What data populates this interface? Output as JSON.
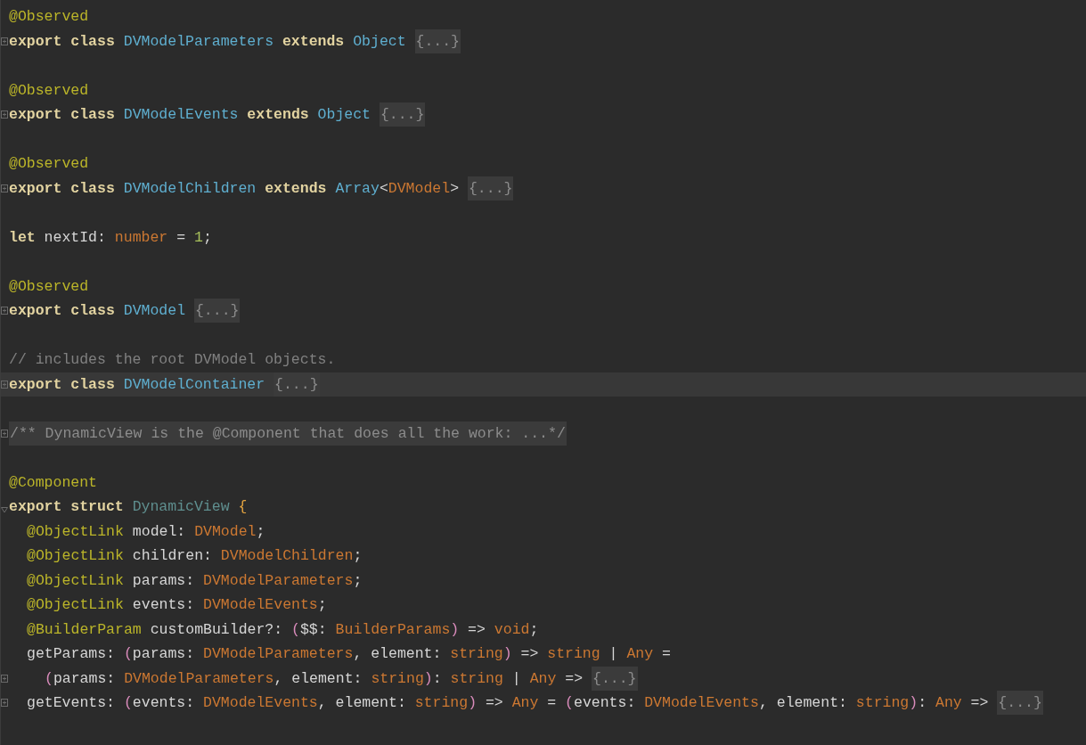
{
  "editor": {
    "lines": [
      {
        "kind": "code",
        "current": false,
        "tokens": [
          {
            "kind": "annotation",
            "text": "@Observed"
          }
        ]
      },
      {
        "kind": "code",
        "current": false,
        "collapsed": true,
        "tokens": [
          {
            "kind": "keyword",
            "text": "export class "
          },
          {
            "kind": "class",
            "text": "DVModelParameters"
          },
          {
            "kind": "keyword",
            "text": " extends "
          },
          {
            "kind": "class",
            "text": "Object "
          },
          {
            "kind": "folded",
            "text": "{...}"
          }
        ]
      },
      {
        "kind": "blank",
        "current": false
      },
      {
        "kind": "code",
        "current": false,
        "tokens": [
          {
            "kind": "annotation",
            "text": "@Observed"
          }
        ]
      },
      {
        "kind": "code",
        "current": false,
        "collapsed": true,
        "tokens": [
          {
            "kind": "keyword",
            "text": "export class "
          },
          {
            "kind": "class",
            "text": "DVModelEvents"
          },
          {
            "kind": "keyword",
            "text": " extends "
          },
          {
            "kind": "class",
            "text": "Object "
          },
          {
            "kind": "folded",
            "text": "{...}"
          }
        ]
      },
      {
        "kind": "blank",
        "current": false
      },
      {
        "kind": "code",
        "current": false,
        "tokens": [
          {
            "kind": "annotation",
            "text": "@Observed"
          }
        ]
      },
      {
        "kind": "code",
        "current": false,
        "collapsed": true,
        "tokens": [
          {
            "kind": "keyword",
            "text": "export class "
          },
          {
            "kind": "class",
            "text": "DVModelChildren"
          },
          {
            "kind": "keyword",
            "text": " extends "
          },
          {
            "kind": "class",
            "text": "Array"
          },
          {
            "kind": "plain",
            "text": "<"
          },
          {
            "kind": "type",
            "text": "DVModel"
          },
          {
            "kind": "plain",
            "text": "> "
          },
          {
            "kind": "folded",
            "text": "{...}"
          }
        ]
      },
      {
        "kind": "blank",
        "current": false
      },
      {
        "kind": "code",
        "current": false,
        "tokens": [
          {
            "kind": "keyword",
            "text": "let "
          },
          {
            "kind": "plain",
            "text": "nextId: "
          },
          {
            "kind": "type",
            "text": "number"
          },
          {
            "kind": "plain",
            "text": " = "
          },
          {
            "kind": "number",
            "text": "1"
          },
          {
            "kind": "plain",
            "text": ";"
          }
        ]
      },
      {
        "kind": "blank",
        "current": false
      },
      {
        "kind": "code",
        "current": false,
        "tokens": [
          {
            "kind": "annotation",
            "text": "@Observed"
          }
        ]
      },
      {
        "kind": "code",
        "current": false,
        "collapsed": true,
        "tokens": [
          {
            "kind": "keyword",
            "text": "export class "
          },
          {
            "kind": "class",
            "text": "DVModel "
          },
          {
            "kind": "folded",
            "text": "{...}"
          }
        ]
      },
      {
        "kind": "blank",
        "current": false
      },
      {
        "kind": "code",
        "current": false,
        "tokens": [
          {
            "kind": "comment",
            "text": "// includes the root DVModel objects."
          }
        ]
      },
      {
        "kind": "code",
        "current": true,
        "collapsed": true,
        "tokens": [
          {
            "kind": "keyword",
            "text": "export class "
          },
          {
            "kind": "class",
            "text": "DVModelContainer "
          },
          {
            "kind": "folded",
            "text": "{...}"
          }
        ]
      },
      {
        "kind": "blank",
        "current": false
      },
      {
        "kind": "code",
        "current": false,
        "collapsed": true,
        "tokens": [
          {
            "kind": "folded_comment",
            "text": "/** DynamicView is the @Component that does all the work: ...*/"
          }
        ]
      },
      {
        "kind": "blank",
        "current": false
      },
      {
        "kind": "code",
        "current": false,
        "tokens": [
          {
            "kind": "annotation",
            "text": "@Component"
          }
        ]
      },
      {
        "kind": "code",
        "current": false,
        "collapsed": false,
        "tokens": [
          {
            "kind": "keyword",
            "text": "export struct "
          },
          {
            "kind": "struct_name",
            "text": "DynamicView "
          },
          {
            "kind": "brace",
            "text": "{"
          }
        ],
        "children": [
          {
            "kind": "code",
            "current": false,
            "tokens": [
              {
                "kind": "annotation",
                "text": "@ObjectLink"
              },
              {
                "kind": "plain",
                "text": " model: "
              },
              {
                "kind": "type",
                "text": "DVModel"
              },
              {
                "kind": "plain",
                "text": ";"
              }
            ]
          },
          {
            "kind": "code",
            "current": false,
            "tokens": [
              {
                "kind": "annotation",
                "text": "@ObjectLink"
              },
              {
                "kind": "plain",
                "text": " children: "
              },
              {
                "kind": "type",
                "text": "DVModelChildren"
              },
              {
                "kind": "plain",
                "text": ";"
              }
            ]
          },
          {
            "kind": "code",
            "current": false,
            "tokens": [
              {
                "kind": "annotation",
                "text": "@ObjectLink"
              },
              {
                "kind": "plain",
                "text": " params: "
              },
              {
                "kind": "type",
                "text": "DVModelParameters"
              },
              {
                "kind": "plain",
                "text": ";"
              }
            ]
          },
          {
            "kind": "code",
            "current": false,
            "tokens": [
              {
                "kind": "annotation",
                "text": "@ObjectLink"
              },
              {
                "kind": "plain",
                "text": " events: "
              },
              {
                "kind": "type",
                "text": "DVModelEvents"
              },
              {
                "kind": "plain",
                "text": ";"
              }
            ]
          },
          {
            "kind": "code",
            "current": false,
            "tokens": [
              {
                "kind": "annotation",
                "text": "@BuilderParam"
              },
              {
                "kind": "plain",
                "text": " customBuilder?: "
              },
              {
                "kind": "paren",
                "text": "("
              },
              {
                "kind": "plain",
                "text": "$$: "
              },
              {
                "kind": "type",
                "text": "BuilderParams"
              },
              {
                "kind": "paren",
                "text": ")"
              },
              {
                "kind": "plain",
                "text": " => "
              },
              {
                "kind": "type",
                "text": "void"
              },
              {
                "kind": "plain",
                "text": ";"
              }
            ]
          },
          {
            "kind": "code",
            "current": false,
            "tokens": [
              {
                "kind": "plain",
                "text": "getParams: "
              },
              {
                "kind": "paren",
                "text": "("
              },
              {
                "kind": "plain",
                "text": "params: "
              },
              {
                "kind": "type",
                "text": "DVModelParameters"
              },
              {
                "kind": "plain",
                "text": ", element: "
              },
              {
                "kind": "type",
                "text": "string"
              },
              {
                "kind": "paren",
                "text": ")"
              },
              {
                "kind": "plain",
                "text": " => "
              },
              {
                "kind": "type",
                "text": "string"
              },
              {
                "kind": "plain",
                "text": " | "
              },
              {
                "kind": "type",
                "text": "Any"
              },
              {
                "kind": "plain",
                "text": " ="
              }
            ],
            "children": [
              {
                "kind": "code",
                "current": false,
                "collapsed": true,
                "tokens": [
                  {
                    "kind": "paren",
                    "text": "("
                  },
                  {
                    "kind": "plain",
                    "text": "params: "
                  },
                  {
                    "kind": "type",
                    "text": "DVModelParameters"
                  },
                  {
                    "kind": "plain",
                    "text": ", element: "
                  },
                  {
                    "kind": "type",
                    "text": "string"
                  },
                  {
                    "kind": "paren",
                    "text": ")"
                  },
                  {
                    "kind": "plain",
                    "text": ": "
                  },
                  {
                    "kind": "type",
                    "text": "string"
                  },
                  {
                    "kind": "plain",
                    "text": " | "
                  },
                  {
                    "kind": "type",
                    "text": "Any"
                  },
                  {
                    "kind": "plain",
                    "text": " => "
                  },
                  {
                    "kind": "folded",
                    "text": "{...}"
                  }
                ]
              }
            ]
          },
          {
            "kind": "code",
            "current": false,
            "collapsed": true,
            "tokens": [
              {
                "kind": "plain",
                "text": "getEvents: "
              },
              {
                "kind": "paren",
                "text": "("
              },
              {
                "kind": "plain",
                "text": "events: "
              },
              {
                "kind": "type",
                "text": "DVModelEvents"
              },
              {
                "kind": "plain",
                "text": ", element: "
              },
              {
                "kind": "type",
                "text": "string"
              },
              {
                "kind": "paren",
                "text": ")"
              },
              {
                "kind": "plain",
                "text": " => "
              },
              {
                "kind": "type",
                "text": "Any"
              },
              {
                "kind": "plain",
                "text": " = "
              },
              {
                "kind": "paren",
                "text": "("
              },
              {
                "kind": "plain",
                "text": "events: "
              },
              {
                "kind": "type",
                "text": "DVModelEvents"
              },
              {
                "kind": "plain",
                "text": ", element: "
              },
              {
                "kind": "type",
                "text": "string"
              },
              {
                "kind": "paren",
                "text": ")"
              },
              {
                "kind": "plain",
                "text": ": "
              },
              {
                "kind": "type",
                "text": "Any"
              },
              {
                "kind": "plain",
                "text": " => "
              },
              {
                "kind": "folded",
                "text": "{...}"
              }
            ]
          }
        ]
      }
    ]
  }
}
